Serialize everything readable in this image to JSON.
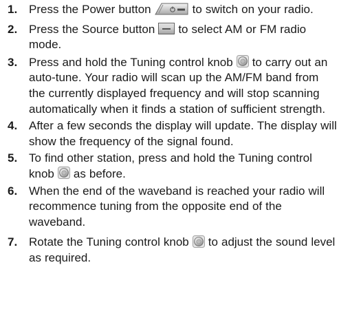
{
  "steps": [
    {
      "number": "1.",
      "before": "Press the Power button ",
      "icon": "power-button-icon",
      "after": " to switch on your radio."
    },
    {
      "number": "2.",
      "before": "Press the Source button ",
      "icon": "source-button-icon",
      "after": " to select AM or FM radio mode."
    },
    {
      "number": "3.",
      "before": "Press and hold the Tuning control knob ",
      "icon": "tuning-knob-icon",
      "after": " to carry out an auto-tune. Your radio will scan up the AM/FM band from the currently displayed frequency and will stop scanning automatically when it finds a station of sufficient strength."
    },
    {
      "number": "4.",
      "before": "After a few seconds the display will update. The display will show the frequency of the signal found.",
      "icon": "",
      "after": ""
    },
    {
      "number": "5.",
      "before": "To find other station, press and hold the Tuning control knob ",
      "icon": "tuning-knob-icon",
      "after": " as before."
    },
    {
      "number": "6.",
      "before": "When the end of the waveband is reached your radio will recommence tuning from the opposite end of the waveband.",
      "icon": "",
      "after": ""
    },
    {
      "number": "7.",
      "before": "Rotate the Tuning control knob ",
      "icon": "tuning-knob-icon",
      "after": " to adjust the sound level as required."
    }
  ]
}
